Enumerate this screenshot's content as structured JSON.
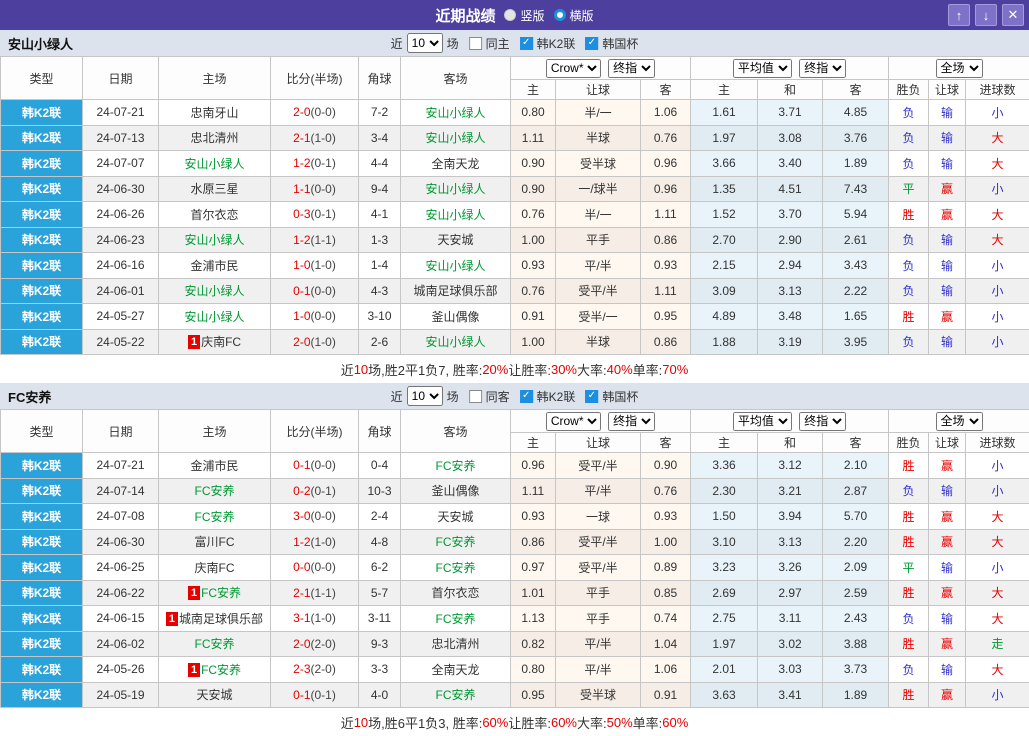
{
  "titlebar": {
    "title": "近期战绩",
    "layout_options": [
      {
        "label": "竖版",
        "selected": false
      },
      {
        "label": "横版",
        "selected": true
      }
    ]
  },
  "icons": {
    "arrow_up": "↑",
    "arrow_down": "↓",
    "close": "✕",
    "check": "✓"
  },
  "colors": {
    "titlebar_bg": "#4C3F9E",
    "league_cell_bg": "#2AA3DB",
    "focus_team": "#009933",
    "win_red": "#E60000",
    "lose_blue": "#3030CC",
    "draw_green": "#009933",
    "checkbox_blue": "#1E8FE0",
    "crow_col_bg": "#FFF8F1",
    "avg_col_bg": "#E9F4FA"
  },
  "table_header": {
    "cols": {
      "type": "类型",
      "date": "日期",
      "home": "主场",
      "score": "比分(半场)",
      "corner": "角球",
      "away": "客场",
      "h_home": "主",
      "h_line": "让球",
      "h_away": "客",
      "avg_home": "主",
      "avg_draw": "和",
      "avg_away": "客",
      "win_lose": "胜负",
      "handicap_res": "让球",
      "goals": "进球数"
    },
    "selects": {
      "source": "Crow*",
      "source_time": "终指",
      "avg": "平均值",
      "avg_time": "终指",
      "scope": "全场"
    }
  },
  "sections": [
    {
      "team": "安山小绿人",
      "filter": {
        "near": "近",
        "count": "10",
        "games": "场",
        "same": "同主",
        "same_checked": false,
        "league1": "韩K2联",
        "league1_checked": true,
        "league2": "韩国杯",
        "league2_checked": true
      },
      "rows": [
        {
          "lg": "韩K2联",
          "date": "24-07-21",
          "home": "忠南牙山",
          "hg": false,
          "hb": "",
          "ft": "2-0",
          "ht": "(0-0)",
          "cn": "7-2",
          "away": "安山小绿人",
          "ag": true,
          "ab": "",
          "o1": "0.80",
          "hc": "半/一",
          "o2": "1.06",
          "m1": "1.61",
          "m2": "3.71",
          "m3": "4.85",
          "wl": "负",
          "wlc": "b",
          "hd": "输",
          "hdc": "b",
          "ou": "小",
          "ouc": "b"
        },
        {
          "lg": "韩K2联",
          "date": "24-07-13",
          "home": "忠北清州",
          "hg": false,
          "hb": "",
          "ft": "2-1",
          "ht": "(1-0)",
          "cn": "3-4",
          "away": "安山小绿人",
          "ag": true,
          "ab": "",
          "o1": "1.11",
          "hc": "半球",
          "o2": "0.76",
          "m1": "1.97",
          "m2": "3.08",
          "m3": "3.76",
          "wl": "负",
          "wlc": "b",
          "hd": "输",
          "hdc": "b",
          "ou": "大",
          "ouc": "r"
        },
        {
          "lg": "韩K2联",
          "date": "24-07-07",
          "home": "安山小绿人",
          "hg": true,
          "hb": "",
          "ft": "1-2",
          "ht": "(0-1)",
          "cn": "4-4",
          "away": "全南天龙",
          "ag": false,
          "ab": "",
          "o1": "0.90",
          "hc": "受半球",
          "o2": "0.96",
          "m1": "3.66",
          "m2": "3.40",
          "m3": "1.89",
          "wl": "负",
          "wlc": "b",
          "hd": "输",
          "hdc": "b",
          "ou": "大",
          "ouc": "r"
        },
        {
          "lg": "韩K2联",
          "date": "24-06-30",
          "home": "水原三星",
          "hg": false,
          "hb": "",
          "ft": "1-1",
          "ht": "(0-0)",
          "cn": "9-4",
          "away": "安山小绿人",
          "ag": true,
          "ab": "",
          "o1": "0.90",
          "hc": "一/球半",
          "o2": "0.96",
          "m1": "1.35",
          "m2": "4.51",
          "m3": "7.43",
          "wl": "平",
          "wlc": "g",
          "hd": "赢",
          "hdc": "r",
          "ou": "小",
          "ouc": "b"
        },
        {
          "lg": "韩K2联",
          "date": "24-06-26",
          "home": "首尔衣恋",
          "hg": false,
          "hb": "",
          "ft": "0-3",
          "ht": "(0-1)",
          "cn": "4-1",
          "away": "安山小绿人",
          "ag": true,
          "ab": "",
          "o1": "0.76",
          "hc": "半/一",
          "o2": "1.11",
          "m1": "1.52",
          "m2": "3.70",
          "m3": "5.94",
          "wl": "胜",
          "wlc": "r",
          "hd": "赢",
          "hdc": "r",
          "ou": "大",
          "ouc": "r"
        },
        {
          "lg": "韩K2联",
          "date": "24-06-23",
          "home": "安山小绿人",
          "hg": true,
          "hb": "",
          "ft": "1-2",
          "ht": "(1-1)",
          "cn": "1-3",
          "away": "天安城",
          "ag": false,
          "ab": "",
          "o1": "1.00",
          "hc": "平手",
          "o2": "0.86",
          "m1": "2.70",
          "m2": "2.90",
          "m3": "2.61",
          "wl": "负",
          "wlc": "b",
          "hd": "输",
          "hdc": "b",
          "ou": "大",
          "ouc": "r"
        },
        {
          "lg": "韩K2联",
          "date": "24-06-16",
          "home": "金浦市民",
          "hg": false,
          "hb": "",
          "ft": "1-0",
          "ht": "(1-0)",
          "cn": "1-4",
          "away": "安山小绿人",
          "ag": true,
          "ab": "",
          "o1": "0.93",
          "hc": "平/半",
          "o2": "0.93",
          "m1": "2.15",
          "m2": "2.94",
          "m3": "3.43",
          "wl": "负",
          "wlc": "b",
          "hd": "输",
          "hdc": "b",
          "ou": "小",
          "ouc": "b"
        },
        {
          "lg": "韩K2联",
          "date": "24-06-01",
          "home": "安山小绿人",
          "hg": true,
          "hb": "",
          "ft": "0-1",
          "ht": "(0-0)",
          "cn": "4-3",
          "away": "城南足球俱乐部",
          "ag": false,
          "ab": "",
          "o1": "0.76",
          "hc": "受平/半",
          "o2": "1.11",
          "m1": "3.09",
          "m2": "3.13",
          "m3": "2.22",
          "wl": "负",
          "wlc": "b",
          "hd": "输",
          "hdc": "b",
          "ou": "小",
          "ouc": "b"
        },
        {
          "lg": "韩K2联",
          "date": "24-05-27",
          "home": "安山小绿人",
          "hg": true,
          "hb": "",
          "ft": "1-0",
          "ht": "(0-0)",
          "cn": "3-10",
          "away": "釜山偶像",
          "ag": false,
          "ab": "",
          "o1": "0.91",
          "hc": "受半/一",
          "o2": "0.95",
          "m1": "4.89",
          "m2": "3.48",
          "m3": "1.65",
          "wl": "胜",
          "wlc": "r",
          "hd": "赢",
          "hdc": "r",
          "ou": "小",
          "ouc": "b"
        },
        {
          "lg": "韩K2联",
          "date": "24-05-22",
          "home": "庆南FC",
          "hg": false,
          "hb": "1",
          "ft": "2-0",
          "ht": "(1-0)",
          "cn": "2-6",
          "away": "安山小绿人",
          "ag": true,
          "ab": "",
          "o1": "1.00",
          "hc": "半球",
          "o2": "0.86",
          "m1": "1.88",
          "m2": "3.19",
          "m3": "3.95",
          "wl": "负",
          "wlc": "b",
          "hd": "输",
          "hdc": "b",
          "ou": "小",
          "ouc": "b"
        }
      ],
      "summary": [
        {
          "t": "近"
        },
        {
          "t": "10",
          "r": true
        },
        {
          "t": "场,胜2平1负7, 胜率:"
        },
        {
          "t": "20%",
          "r": true
        },
        {
          "t": " 让胜率:"
        },
        {
          "t": "30%",
          "r": true
        },
        {
          "t": " 大率:"
        },
        {
          "t": "40%",
          "r": true
        },
        {
          "t": " 单率:"
        },
        {
          "t": "70%",
          "r": true
        }
      ]
    },
    {
      "team": "FC安养",
      "filter": {
        "near": "近",
        "count": "10",
        "games": "场",
        "same": "同客",
        "same_checked": false,
        "league1": "韩K2联",
        "league1_checked": true,
        "league2": "韩国杯",
        "league2_checked": true
      },
      "rows": [
        {
          "lg": "韩K2联",
          "date": "24-07-21",
          "home": "金浦市民",
          "hg": false,
          "hb": "",
          "ft": "0-1",
          "ht": "(0-0)",
          "cn": "0-4",
          "away": "FC安养",
          "ag": true,
          "ab": "",
          "o1": "0.96",
          "hc": "受平/半",
          "o2": "0.90",
          "m1": "3.36",
          "m2": "3.12",
          "m3": "2.10",
          "wl": "胜",
          "wlc": "r",
          "hd": "赢",
          "hdc": "r",
          "ou": "小",
          "ouc": "b"
        },
        {
          "lg": "韩K2联",
          "date": "24-07-14",
          "home": "FC安养",
          "hg": true,
          "hb": "",
          "ft": "0-2",
          "ht": "(0-1)",
          "cn": "10-3",
          "away": "釜山偶像",
          "ag": false,
          "ab": "",
          "o1": "1.11",
          "hc": "平/半",
          "o2": "0.76",
          "m1": "2.30",
          "m2": "3.21",
          "m3": "2.87",
          "wl": "负",
          "wlc": "b",
          "hd": "输",
          "hdc": "b",
          "ou": "小",
          "ouc": "b"
        },
        {
          "lg": "韩K2联",
          "date": "24-07-08",
          "home": "FC安养",
          "hg": true,
          "hb": "",
          "ft": "3-0",
          "ht": "(0-0)",
          "cn": "2-4",
          "away": "天安城",
          "ag": false,
          "ab": "",
          "o1": "0.93",
          "hc": "一球",
          "o2": "0.93",
          "m1": "1.50",
          "m2": "3.94",
          "m3": "5.70",
          "wl": "胜",
          "wlc": "r",
          "hd": "赢",
          "hdc": "r",
          "ou": "大",
          "ouc": "r"
        },
        {
          "lg": "韩K2联",
          "date": "24-06-30",
          "home": "富川FC",
          "hg": false,
          "hb": "",
          "ft": "1-2",
          "ht": "(1-0)",
          "cn": "4-8",
          "away": "FC安养",
          "ag": true,
          "ab": "",
          "o1": "0.86",
          "hc": "受平/半",
          "o2": "1.00",
          "m1": "3.10",
          "m2": "3.13",
          "m3": "2.20",
          "wl": "胜",
          "wlc": "r",
          "hd": "赢",
          "hdc": "r",
          "ou": "大",
          "ouc": "r"
        },
        {
          "lg": "韩K2联",
          "date": "24-06-25",
          "home": "庆南FC",
          "hg": false,
          "hb": "",
          "ft": "0-0",
          "ht": "(0-0)",
          "cn": "6-2",
          "away": "FC安养",
          "ag": true,
          "ab": "",
          "o1": "0.97",
          "hc": "受平/半",
          "o2": "0.89",
          "m1": "3.23",
          "m2": "3.26",
          "m3": "2.09",
          "wl": "平",
          "wlc": "g",
          "hd": "输",
          "hdc": "b",
          "ou": "小",
          "ouc": "b"
        },
        {
          "lg": "韩K2联",
          "date": "24-06-22",
          "home": "FC安养",
          "hg": true,
          "hb": "1",
          "ft": "2-1",
          "ht": "(1-1)",
          "cn": "5-7",
          "away": "首尔衣恋",
          "ag": false,
          "ab": "",
          "o1": "1.01",
          "hc": "平手",
          "o2": "0.85",
          "m1": "2.69",
          "m2": "2.97",
          "m3": "2.59",
          "wl": "胜",
          "wlc": "r",
          "hd": "赢",
          "hdc": "r",
          "ou": "大",
          "ouc": "r"
        },
        {
          "lg": "韩K2联",
          "date": "24-06-15",
          "home": "城南足球俱乐部",
          "hg": false,
          "hb": "1",
          "ft": "3-1",
          "ht": "(1-0)",
          "cn": "3-11",
          "away": "FC安养",
          "ag": true,
          "ab": "",
          "o1": "1.13",
          "hc": "平手",
          "o2": "0.74",
          "m1": "2.75",
          "m2": "3.11",
          "m3": "2.43",
          "wl": "负",
          "wlc": "b",
          "hd": "输",
          "hdc": "b",
          "ou": "大",
          "ouc": "r"
        },
        {
          "lg": "韩K2联",
          "date": "24-06-02",
          "home": "FC安养",
          "hg": true,
          "hb": "",
          "ft": "2-0",
          "ht": "(2-0)",
          "cn": "9-3",
          "away": "忠北清州",
          "ag": false,
          "ab": "",
          "o1": "0.82",
          "hc": "平/半",
          "o2": "1.04",
          "m1": "1.97",
          "m2": "3.02",
          "m3": "3.88",
          "wl": "胜",
          "wlc": "r",
          "hd": "赢",
          "hdc": "r",
          "ou": "走",
          "ouc": "g"
        },
        {
          "lg": "韩K2联",
          "date": "24-05-26",
          "home": "FC安养",
          "hg": true,
          "hb": "1",
          "ft": "2-3",
          "ht": "(2-0)",
          "cn": "3-3",
          "away": "全南天龙",
          "ag": false,
          "ab": "",
          "o1": "0.80",
          "hc": "平/半",
          "o2": "1.06",
          "m1": "2.01",
          "m2": "3.03",
          "m3": "3.73",
          "wl": "负",
          "wlc": "b",
          "hd": "输",
          "hdc": "b",
          "ou": "大",
          "ouc": "r"
        },
        {
          "lg": "韩K2联",
          "date": "24-05-19",
          "home": "天安城",
          "hg": false,
          "hb": "",
          "ft": "0-1",
          "ht": "(0-1)",
          "cn": "4-0",
          "away": "FC安养",
          "ag": true,
          "ab": "",
          "o1": "0.95",
          "hc": "受半球",
          "o2": "0.91",
          "m1": "3.63",
          "m2": "3.41",
          "m3": "1.89",
          "wl": "胜",
          "wlc": "r",
          "hd": "赢",
          "hdc": "r",
          "ou": "小",
          "ouc": "b"
        }
      ],
      "summary": [
        {
          "t": "近"
        },
        {
          "t": "10",
          "r": true
        },
        {
          "t": "场,胜6平1负3, 胜率:"
        },
        {
          "t": "60%",
          "r": true
        },
        {
          "t": " 让胜率:"
        },
        {
          "t": "60%",
          "r": true
        },
        {
          "t": " 大率:"
        },
        {
          "t": "50%",
          "r": true
        },
        {
          "t": " 单率:"
        },
        {
          "t": "60%",
          "r": true
        }
      ]
    }
  ]
}
